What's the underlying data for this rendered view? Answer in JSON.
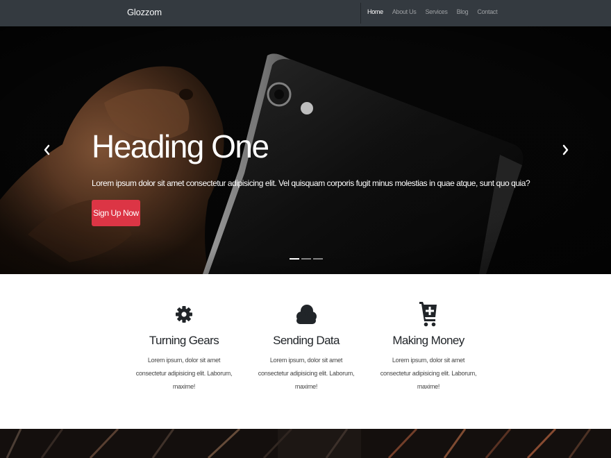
{
  "navbar": {
    "brand": "Glozzom",
    "links": [
      {
        "label": "Home",
        "active": true
      },
      {
        "label": "About Us",
        "active": false
      },
      {
        "label": "Services",
        "active": false
      },
      {
        "label": "Blog",
        "active": false
      },
      {
        "label": "Contact",
        "active": false
      }
    ]
  },
  "hero": {
    "title": "Heading One",
    "text": "Lorem ipsum dolor sit amet consectetur adipisicing elit. Vel quisquam corporis fugit minus molestias in quae atque, sunt quo quia?",
    "button_label": "Sign Up Now",
    "button_color": "#dc3545",
    "prev_icon": "chevron-left-icon",
    "next_icon": "chevron-right-icon",
    "active_slide": 1,
    "slide_count": 3
  },
  "features": [
    {
      "icon": "gear-icon",
      "title": "Turning Gears",
      "text": "Lorem ipsum, dolor sit amet consectetur adipisicing elit. Laborum, maxime!"
    },
    {
      "icon": "cloud-icon",
      "title": "Sending Data",
      "text": "Lorem ipsum, dolor sit amet consectetur adipisicing elit. Laborum, maxime!"
    },
    {
      "icon": "cart-plus-icon",
      "title": "Making Money",
      "text": "Lorem ipsum, dolor sit amet consectetur adipisicing elit. Laborum, maxime!"
    }
  ],
  "colors": {
    "navbar_bg": "#343a40",
    "accent": "#dc3545",
    "text": "#212529"
  }
}
